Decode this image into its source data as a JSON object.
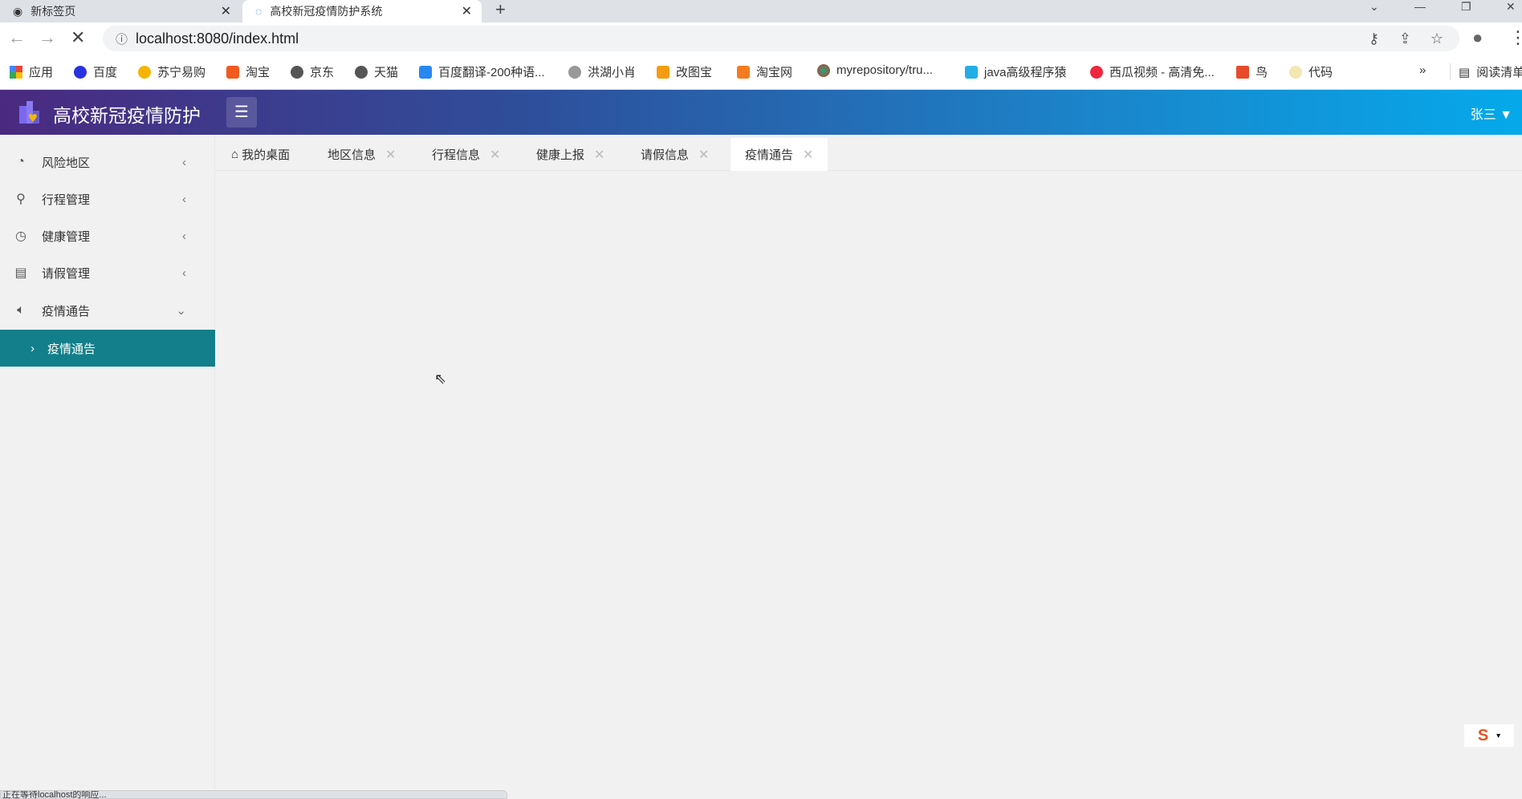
{
  "browser": {
    "tabs": [
      {
        "title": "新标签页",
        "close": "✕"
      },
      {
        "title": "高校新冠疫情防护系统",
        "close": "✕"
      }
    ],
    "new_tab": "+",
    "url": "localhost:8080/index.html",
    "bookmarks": [
      "应用",
      "百度",
      "苏宁易购",
      "淘宝",
      "京东",
      "天猫",
      "百度翻译-200种语...",
      "洪湖小肖",
      "改图宝",
      "淘宝网",
      "myrepository/tru...",
      "java高级程序猿",
      "西瓜视频 - 高清免...",
      "鸟",
      "代码"
    ],
    "more": "»",
    "reading_list": "阅读清单",
    "status": "正在等待localhost的响应..."
  },
  "app": {
    "brand": "高校新冠疫情防护",
    "user": "张三",
    "sidebar": [
      {
        "label": "风险地区",
        "icon": "globe-icon",
        "arrow": "‹"
      },
      {
        "label": "行程管理",
        "icon": "location-icon",
        "arrow": "‹"
      },
      {
        "label": "健康管理",
        "icon": "health-icon",
        "arrow": "‹"
      },
      {
        "label": "请假管理",
        "icon": "document-icon",
        "arrow": "‹"
      },
      {
        "label": "疫情通告",
        "icon": "speaker-icon",
        "arrow": "⌄"
      }
    ],
    "submenu": {
      "label": "疫情通告",
      "active": true
    },
    "tabs": [
      {
        "label": "我的桌面"
      },
      {
        "label": "地区信息"
      },
      {
        "label": "行程信息"
      },
      {
        "label": "健康上报"
      },
      {
        "label": "请假信息"
      },
      {
        "label": "疫情通告",
        "active": true
      }
    ],
    "tab_close": "✕",
    "accent": "#127f8a"
  }
}
